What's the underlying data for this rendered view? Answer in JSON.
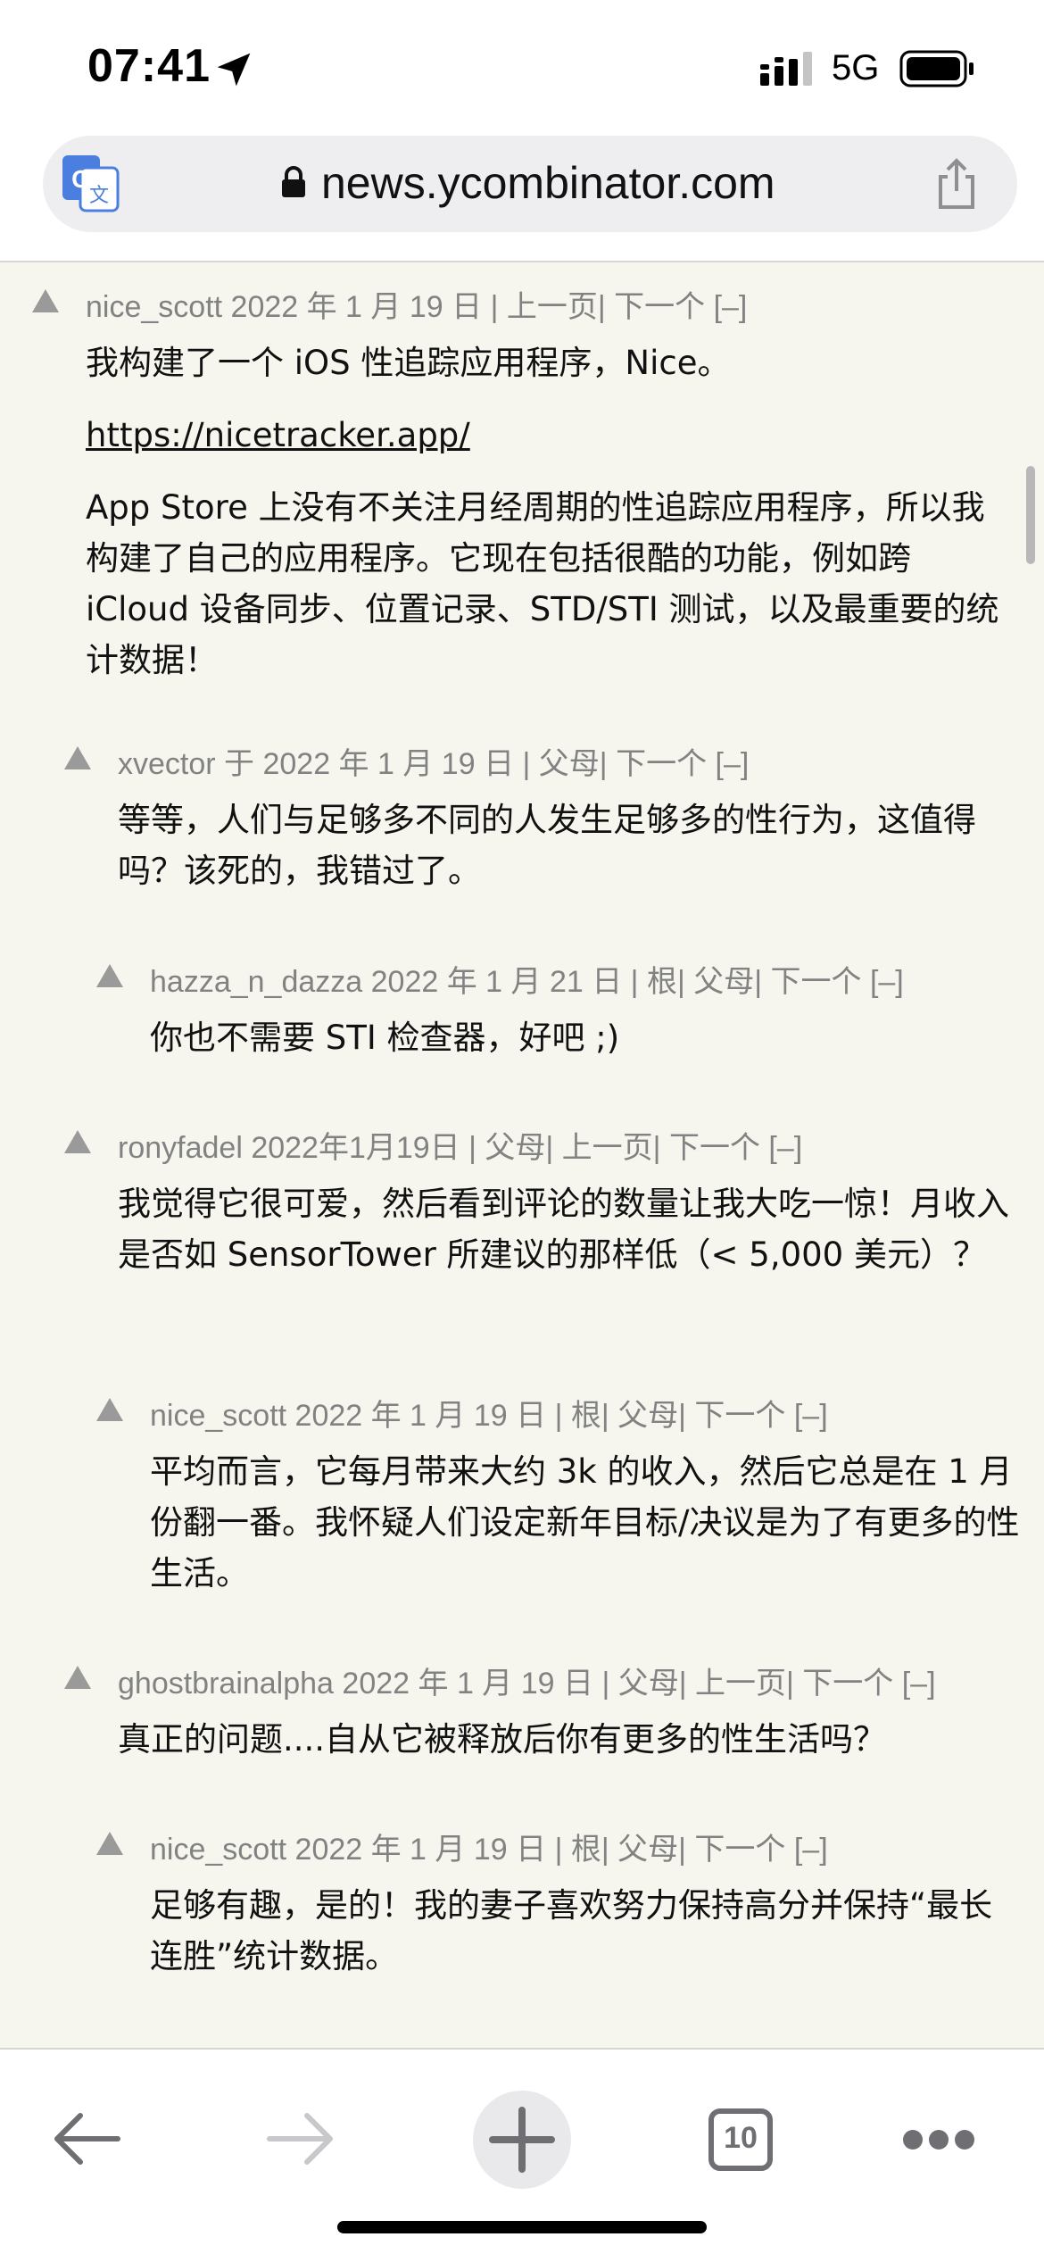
{
  "status_bar": {
    "time": "07:41",
    "network": "5G"
  },
  "url_bar": {
    "url": "news.ycombinator.com"
  },
  "comments": [
    {
      "meta": "nice_scott 2022 年 1 月 19 日 | 上一页| 下一个 [–]",
      "paragraphs": [
        "我构建了一个 iOS 性追踪应用程序，Nice。"
      ],
      "link": "https://nicetracker.app/",
      "paragraphs_after": [
        "App Store 上没有不关注月经周期的性追踪应用程序，所以我构建了自己的应用程序。它现在包括很酷的功能，例如跨 iCloud 设备同步、位置记录、STD/STI 测试，以及最重要的统计数据！"
      ]
    },
    {
      "meta": "xvector 于 2022 年 1 月 19 日 | 父母| 下一个 [–]",
      "text": "等等，人们与足够多不同的人发生足够多的性行为，这值得吗？该死的，我错过了。"
    },
    {
      "meta": "hazza_n_dazza 2022 年 1 月 21 日 | 根| 父母| 下一个 [–]",
      "text": "你也不需要 STI 检查器，好吧 ;)"
    },
    {
      "meta": "ronyfadel 2022年1月19日 | 父母| 上一页| 下一个 [–]",
      "text": "我觉得它很可爱，然后看到评论的数量让我大吃一惊！月收入是否如 SensorTower 所建议的那样低（< 5,000 美元）？"
    },
    {
      "meta": "nice_scott 2022 年 1 月 19 日 | 根| 父母| 下一个 [–]",
      "text": "平均而言，它每月带来大约 3k 的收入，然后它总是在 1 月份翻一番。我怀疑人们设定新年目标/决议是为了有更多的性生活。"
    },
    {
      "meta": "ghostbrainalpha 2022 年 1 月 19 日 | 父母| 上一页| 下一个 [–]",
      "text": "真正的问题....自从它被释放后你有更多的性生活吗？"
    },
    {
      "meta": "nice_scott 2022 年 1 月 19 日 | 根| 父母| 下一个 [–]",
      "text": "足够有趣，是的！我的妻子喜欢努力保持高分并保持“最长连胜”统计数据。"
    }
  ],
  "toolbar": {
    "tab_count": "10"
  },
  "icons": [
    "location-arrow-icon",
    "signal-icon",
    "battery-icon",
    "translate-icon",
    "lock-icon",
    "share-icon",
    "upvote-arrow-icon",
    "back-arrow-icon",
    "forward-arrow-icon",
    "plus-icon",
    "tabs-icon",
    "more-icon"
  ],
  "colors": {
    "page_bg": "#f6f6ef",
    "meta_text": "#828282",
    "arrow": "#9a9a9a"
  }
}
